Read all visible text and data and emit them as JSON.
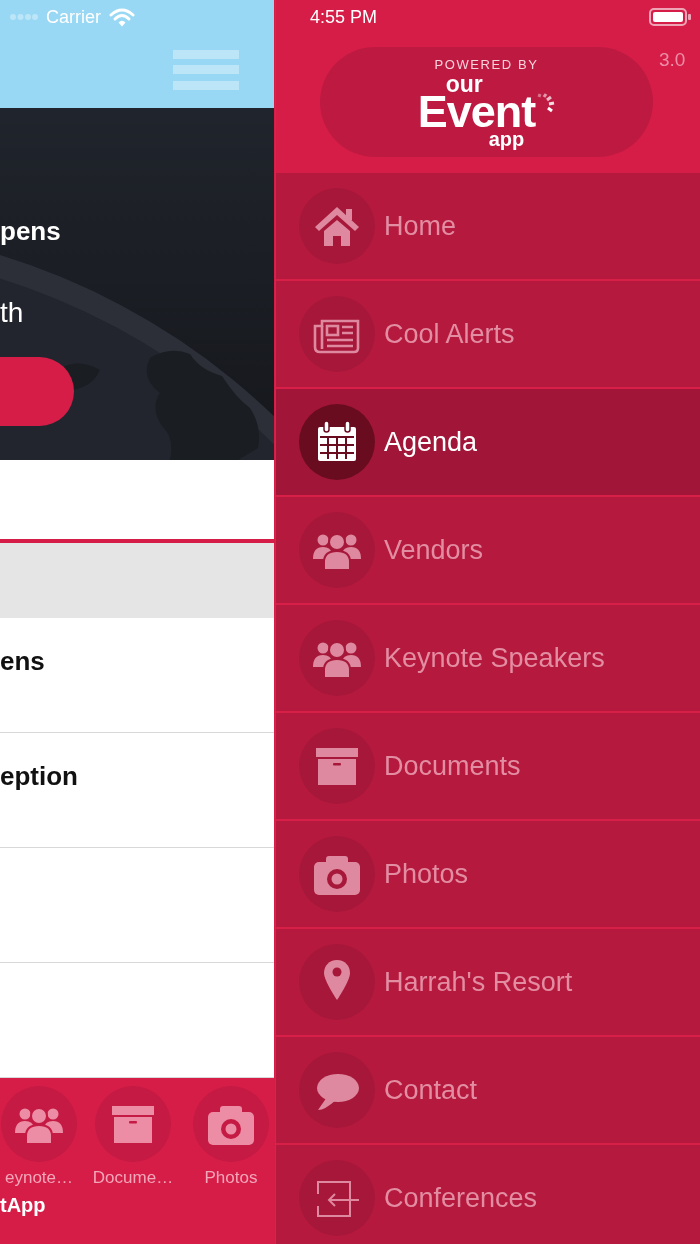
{
  "status_bar": {
    "carrier": "Carrier",
    "time": "4:55 PM"
  },
  "main_screen": {
    "hero": {
      "title": "pens",
      "subtitle": "th"
    },
    "agenda_rows": [
      {
        "title": "ens"
      },
      {
        "title": "eption"
      }
    ],
    "tab_bar": {
      "items": [
        {
          "label": "eynote…"
        },
        {
          "label": "Docume…"
        },
        {
          "label": "Photos"
        }
      ],
      "caption": "tApp"
    }
  },
  "drawer": {
    "logo": {
      "tagline": "POWERED BY",
      "line_1": "our",
      "line_2": "Event",
      "line_3": "app"
    },
    "version": "3.0",
    "menu": [
      {
        "label": "Home",
        "selected": false
      },
      {
        "label": "Cool Alerts",
        "selected": false
      },
      {
        "label": "Agenda",
        "selected": true
      },
      {
        "label": "Vendors",
        "selected": false
      },
      {
        "label": "Keynote Speakers",
        "selected": false
      },
      {
        "label": "Documents",
        "selected": false
      },
      {
        "label": "Photos",
        "selected": false
      },
      {
        "label": "Harrah's Resort",
        "selected": false
      },
      {
        "label": "Contact",
        "selected": false
      },
      {
        "label": "Conferences",
        "selected": false
      }
    ]
  }
}
